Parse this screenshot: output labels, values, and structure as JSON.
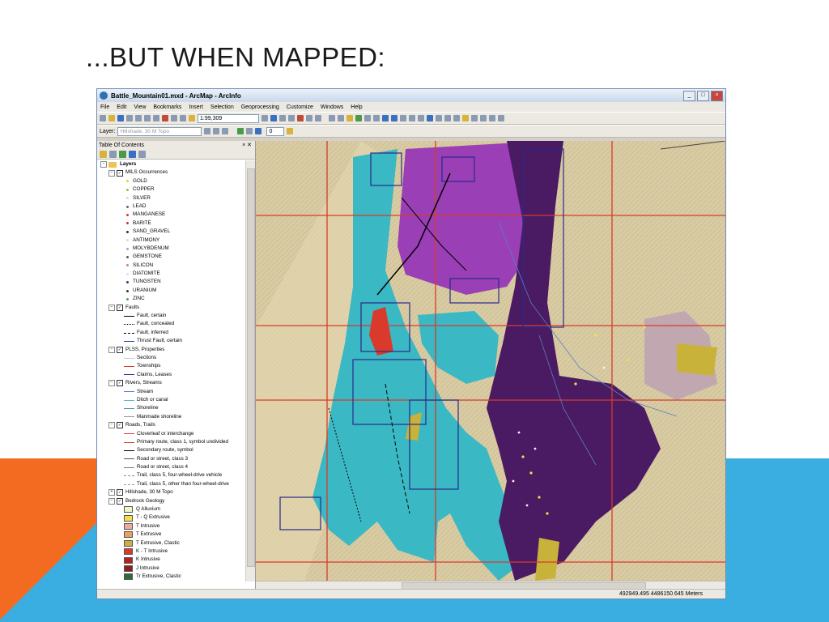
{
  "slide": {
    "title": "...BUT WHEN MAPPED:"
  },
  "app": {
    "window_title": "Battle_Mountain01.mxd - ArcMap - ArcInfo",
    "menu": [
      "File",
      "Edit",
      "View",
      "Bookmarks",
      "Insert",
      "Selection",
      "Geoprocessing",
      "Customize",
      "Windows",
      "Help"
    ],
    "toolbar": {
      "scale": "1:99,309",
      "layer_label": "Layer:",
      "layer_value": "Hillshade, 30 M Topo",
      "number_value": "0"
    },
    "toc": {
      "title": "Table Of Contents",
      "root": "Layers",
      "groups": [
        {
          "name": "MILS Occurrences",
          "items": [
            {
              "label": "GOLD",
              "color": "#e8d23a"
            },
            {
              "label": "COPPER",
              "color": "#8fbc5a"
            },
            {
              "label": "SILVER",
              "color": "#d9d9d9"
            },
            {
              "label": "LEAD",
              "color": "#6e5a99"
            },
            {
              "label": "MANGANESE",
              "color": "#d93a2b"
            },
            {
              "label": "BARITE",
              "color": "#c0392b"
            },
            {
              "label": "SAND_GRAVEL",
              "color": "#333333"
            },
            {
              "label": "ANTIMONY",
              "color": "#e8e0b0"
            },
            {
              "label": "MOLYBDENUM",
              "color": "#b0a0c8"
            },
            {
              "label": "GEMSTONE",
              "color": "#5a5a5a"
            },
            {
              "label": "SILICON",
              "color": "#c47ab8"
            },
            {
              "label": "DIATOMITE",
              "color": "#e4e4e4"
            },
            {
              "label": "TUNGSTEN",
              "color": "#2a3f7a"
            },
            {
              "label": "URANIUM",
              "color": "#3c3c3c"
            },
            {
              "label": "ZINC",
              "color": "#4aa84a"
            }
          ]
        },
        {
          "name": "Faults",
          "items": [
            {
              "label": "Fault, certain",
              "color": "#000000",
              "style": "solid"
            },
            {
              "label": "Fault, concealed",
              "color": "#000000",
              "style": "dotted"
            },
            {
              "label": "Fault, inferred",
              "color": "#000000",
              "style": "dashed"
            },
            {
              "label": "Thrust Fault, certain",
              "color": "#1a4aa0",
              "style": "solid"
            }
          ]
        },
        {
          "name": "PLSS, Properties",
          "items": [
            {
              "label": "Sections",
              "color": "#cccccc",
              "style": "solid"
            },
            {
              "label": "Townships",
              "color": "#d93a2b",
              "style": "solid"
            },
            {
              "label": "Claims, Leases",
              "color": "#2a2a8a",
              "style": "solid"
            }
          ]
        },
        {
          "name": "Rivers, Streams",
          "items": [
            {
              "label": "Stream",
              "color": "#5a7fc0",
              "style": "solid"
            },
            {
              "label": "Ditch or canal",
              "color": "#6ab0d0",
              "style": "solid"
            },
            {
              "label": "Shoreline",
              "color": "#3a9aa0",
              "style": "solid"
            },
            {
              "label": "Manmade shoreline",
              "color": "#7aa0b0",
              "style": "solid"
            }
          ]
        },
        {
          "name": "Roads, Trails",
          "items": [
            {
              "label": "Cloverleaf or interchange",
              "color": "#d93a2b",
              "style": "solid"
            },
            {
              "label": "Primary route, class 1, symbol undivided",
              "color": "#d93a2b",
              "style": "solid"
            },
            {
              "label": "Secondary route, symbol",
              "color": "#000000",
              "style": "solid"
            },
            {
              "label": "Road or street, class 3",
              "color": "#555555",
              "style": "solid"
            },
            {
              "label": "Road or street, class 4",
              "color": "#777777",
              "style": "solid"
            },
            {
              "label": "Trail, class 5, four-wheel-drive vehicle",
              "color": "#888888",
              "style": "dashed"
            },
            {
              "label": "Trail, class 5, other than four-wheel-drive",
              "color": "#999999",
              "style": "dashed"
            }
          ]
        },
        {
          "name": "Hillshade, 30 M Topo",
          "items": []
        },
        {
          "name": "Bedrock Geology",
          "items": [
            {
              "label": "Q Alluvium",
              "color": "#f6f2c8"
            },
            {
              "label": "T - Q Extrusive",
              "color": "#f2e04a"
            },
            {
              "label": "T Intrusive",
              "color": "#f0a8a0"
            },
            {
              "label": "T Extrusive",
              "color": "#e8a060"
            },
            {
              "label": "T Extrusive, Clastic",
              "color": "#c9b23a"
            },
            {
              "label": "K - T Intrusive",
              "color": "#d93a2b"
            },
            {
              "label": "K Intrusive",
              "color": "#b82020"
            },
            {
              "label": "J Intrusive",
              "color": "#8a1f1f"
            },
            {
              "label": "Tr Extrusive, Clastic",
              "color": "#2f6a3a"
            }
          ]
        }
      ]
    },
    "status": {
      "coordinates": "492949.495  4486150.645 Meters"
    }
  }
}
